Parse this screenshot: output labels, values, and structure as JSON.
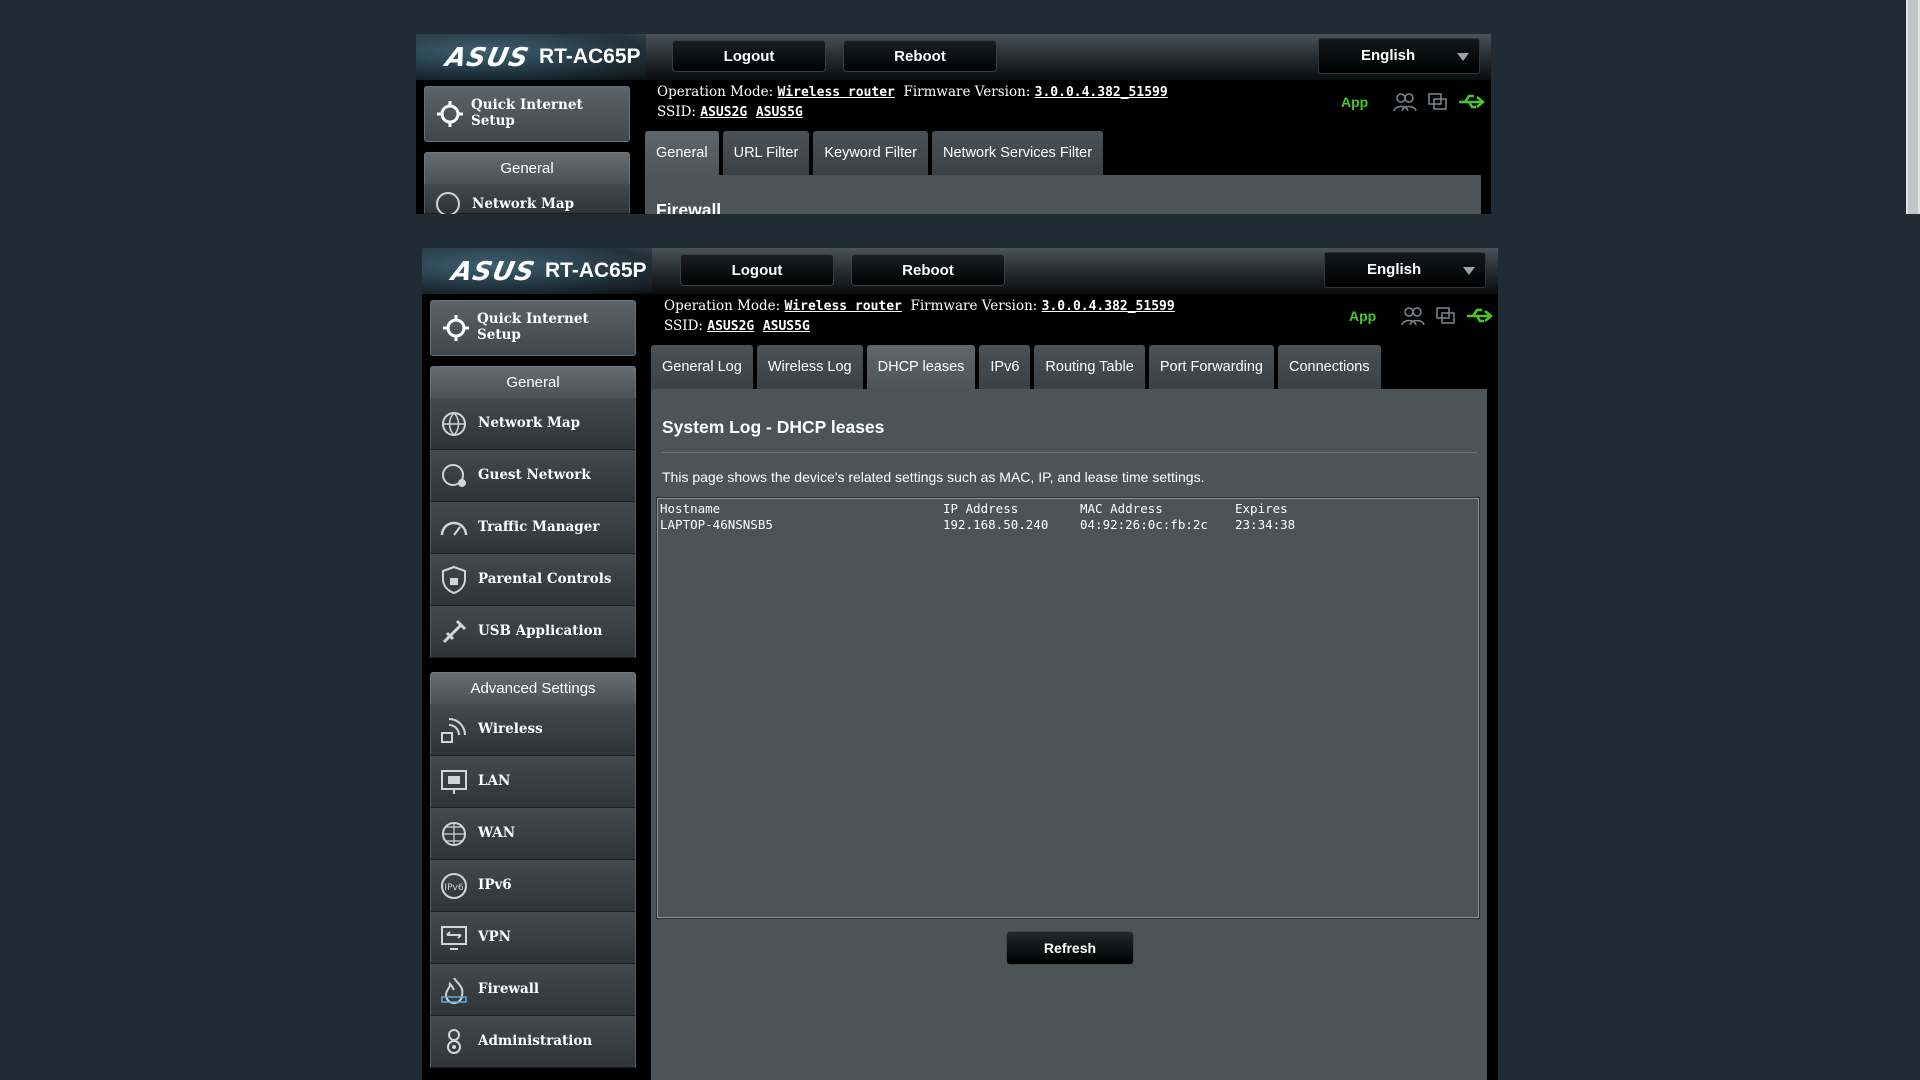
{
  "brand": {
    "logo": "ASUS",
    "model": "RT-AC65P"
  },
  "header": {
    "logout_label": "Logout",
    "reboot_label": "Reboot",
    "language": "English"
  },
  "status": {
    "op_mode_label": "Operation Mode:",
    "op_mode_value": "Wireless router",
    "fw_label": "Firmware Version:",
    "fw_value": "3.0.0.4.382_51599",
    "ssid_label": "SSID:",
    "ssid_2g": "ASUS2G",
    "ssid_5g": "ASUS5G",
    "app_label": "App"
  },
  "sidebar": {
    "qis_label": "Quick Internet Setup",
    "general_header": "General",
    "general_items": [
      {
        "label": "Network Map",
        "icon": "network-map-icon"
      },
      {
        "label": "Guest Network",
        "icon": "guest-network-icon"
      },
      {
        "label": "Traffic Manager",
        "icon": "traffic-manager-icon"
      },
      {
        "label": "Parental Controls",
        "icon": "parental-controls-icon"
      },
      {
        "label": "USB Application",
        "icon": "usb-application-icon"
      }
    ],
    "advanced_header": "Advanced Settings",
    "advanced_items": [
      {
        "label": "Wireless",
        "icon": "wireless-icon"
      },
      {
        "label": "LAN",
        "icon": "lan-icon"
      },
      {
        "label": "WAN",
        "icon": "wan-icon"
      },
      {
        "label": "IPv6",
        "icon": "ipv6-icon"
      },
      {
        "label": "VPN",
        "icon": "vpn-icon"
      },
      {
        "label": "Firewall",
        "icon": "firewall-icon"
      },
      {
        "label": "Administration",
        "icon": "administration-icon"
      }
    ],
    "top_partial_item": "Network Map"
  },
  "top_window": {
    "tabs": [
      "General",
      "URL Filter",
      "Keyword Filter",
      "Network Services Filter"
    ],
    "active_tab": "General",
    "content_title_partial": "Firewall"
  },
  "main_window": {
    "tabs": [
      "General Log",
      "Wireless Log",
      "DHCP leases",
      "IPv6",
      "Routing Table",
      "Port Forwarding",
      "Connections"
    ],
    "active_tab": "DHCP leases",
    "page_title": "System Log - DHCP leases",
    "description": "This page shows the device's related settings such as MAC, IP, and lease time settings.",
    "log_columns": [
      "Hostname",
      "IP Address",
      "MAC Address",
      "Expires"
    ],
    "log_rows": [
      [
        "LAPTOP-46NSNSB5",
        "192.168.50.240",
        "04:92:26:0c:fb:2c",
        "23:34:38"
      ]
    ],
    "refresh_label": "Refresh"
  },
  "colors": {
    "background": "#1f2c36",
    "accent_green": "#48c72a",
    "content_bg": "#4c5458"
  }
}
